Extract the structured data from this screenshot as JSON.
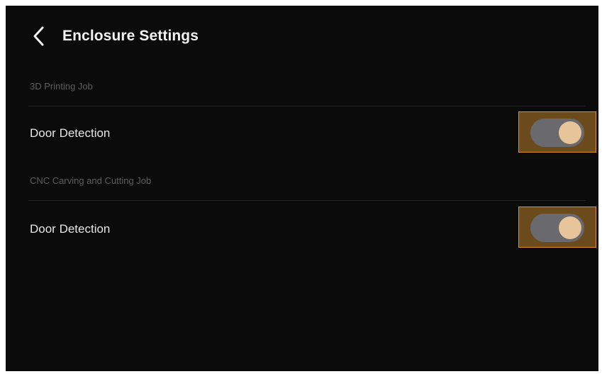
{
  "header": {
    "title": "Enclosure Settings",
    "back_icon": "chevron-left-icon"
  },
  "sections": [
    {
      "label": "3D Printing Job",
      "setting": {
        "label": "Door Detection",
        "enabled": true
      }
    },
    {
      "label": "CNC Carving and Cutting Job",
      "setting": {
        "label": "Door Detection",
        "enabled": true
      }
    }
  ],
  "colors": {
    "background": "#0b0b0b",
    "toggle_track": "#6a6a6e",
    "toggle_knob": "#e8c49a",
    "highlight_fill": "#6b4a1c",
    "highlight_border": "#e0922a"
  }
}
